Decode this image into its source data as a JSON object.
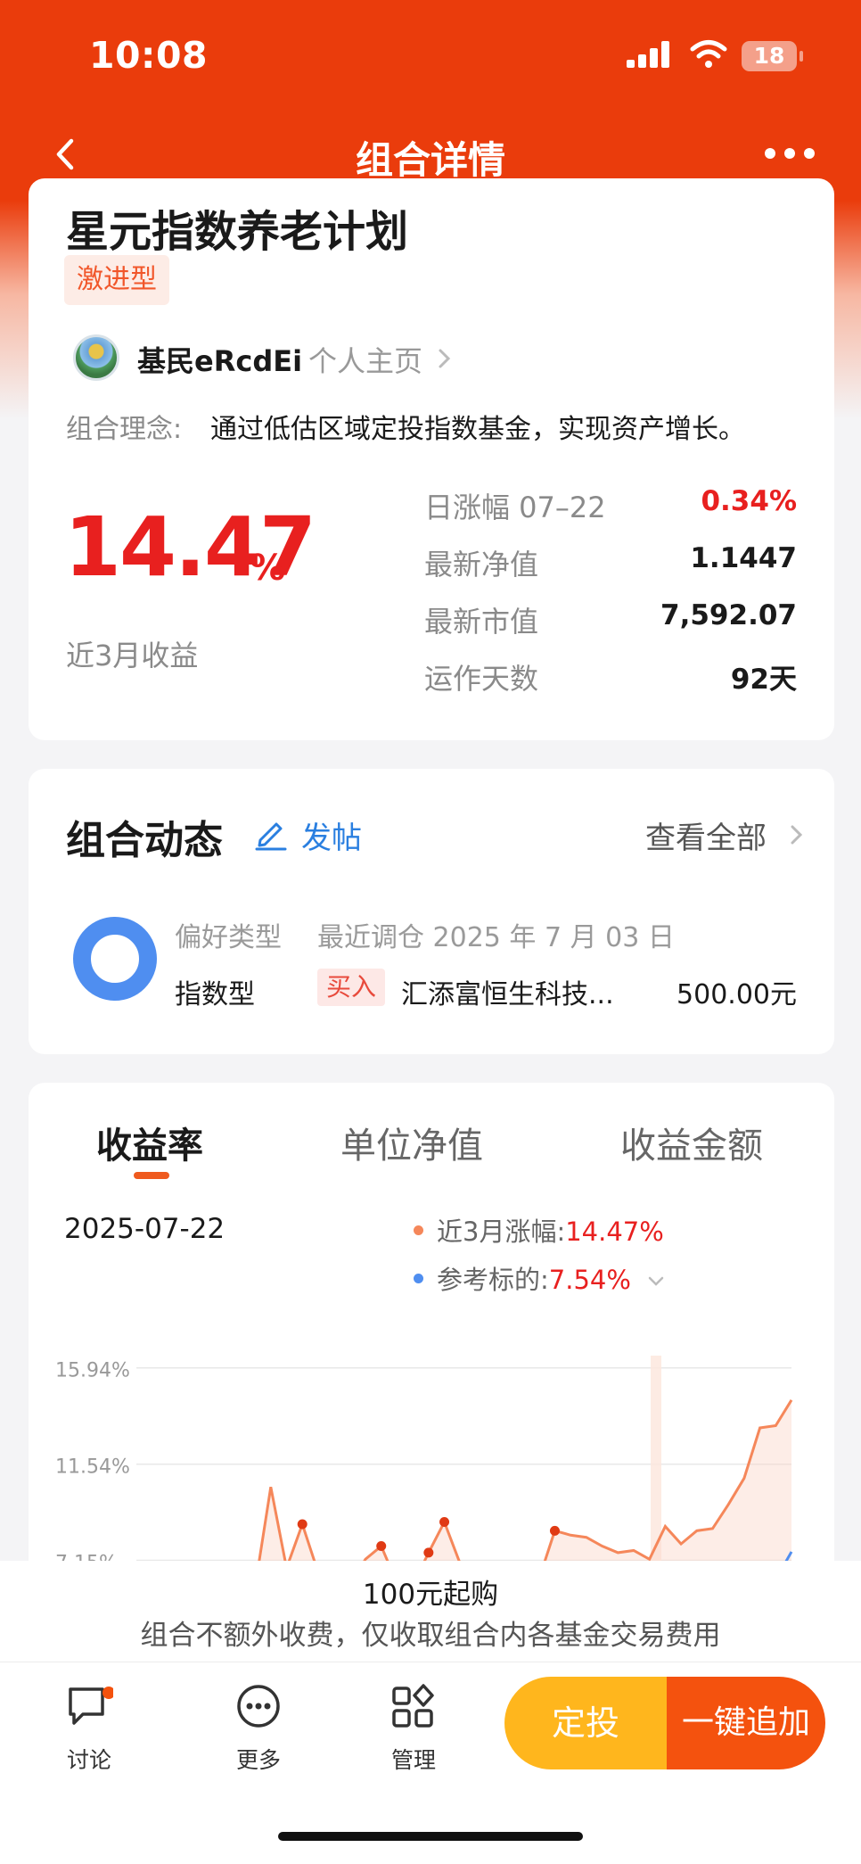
{
  "status_bar": {
    "time": "10:08",
    "battery": "18"
  },
  "nav": {
    "title": "组合详情"
  },
  "plan": {
    "name": "星元指数养老计划",
    "risk_tag": "激进型",
    "user_name": "基民eRcdEi",
    "user_link": "个人主页",
    "concept_label": "组合理念:",
    "concept_text": "通过低估区域定投指数基金，实现资产增长。",
    "return_value": "14.47",
    "return_unit": "%",
    "return_label": "近3月收益",
    "stats": [
      {
        "label": "日涨幅 07–22",
        "value": "0.34%"
      },
      {
        "label": "最新净值",
        "value": "1.1447"
      },
      {
        "label": "最新市值",
        "value": "7,592.07"
      },
      {
        "label": "运作天数",
        "value": "92天"
      }
    ]
  },
  "dynamics": {
    "title": "组合动态",
    "post": "发帖",
    "view_all": "查看全部",
    "pref_label": "偏好类型",
    "pref_value": "指数型",
    "rebalance_label": "最近调仓 2025 年 7 月 03 日",
    "buy_tag": "买入",
    "fund_name": "汇添富恒生科技...",
    "amount": "500.00元"
  },
  "chart_tabs": [
    "收益率",
    "单位净值",
    "收益金额"
  ],
  "chart_info": {
    "date": "2025-07-22",
    "legend_1_label": "近3月涨幅:",
    "legend_1_value": "14.47%",
    "legend_2_label": "参考标的:",
    "legend_2_value": "7.54%",
    "legend_1_color": "#f5875a",
    "legend_2_color": "#4f8ef0"
  },
  "chart_data": {
    "type": "line",
    "yticks": [
      "15.94%",
      "11.54%",
      "7.15%"
    ],
    "ylim": [
      5.5,
      16.5
    ],
    "series": [
      {
        "name": "近3月涨幅",
        "color": "#f5875a",
        "values": [
          6.2,
          6.9,
          6.3,
          5.9,
          10.5,
          6.8,
          8.8,
          6.6,
          6.7,
          6.0,
          7.2,
          7.8,
          6.1,
          6.0,
          7.5,
          8.9,
          7.0,
          6.5,
          6.9,
          6.4,
          6.0,
          6.3,
          8.5,
          8.3,
          8.2,
          7.8,
          7.5,
          7.6,
          7.2,
          8.7,
          7.9,
          8.5,
          8.6,
          9.7,
          10.9,
          13.2,
          13.3,
          14.47
        ]
      },
      {
        "name": "参考标的",
        "color": "#4f8ef0",
        "values": [
          6.0,
          6.1,
          7.54
        ]
      }
    ]
  },
  "bottom": {
    "buy_min": "100元起购",
    "fee_note": "组合不额外收费，仅收取组合内各基金交易费用",
    "tabs": [
      "讨论",
      "更多",
      "管理"
    ],
    "cta_primary": "定投",
    "cta_secondary": "一键追加"
  }
}
